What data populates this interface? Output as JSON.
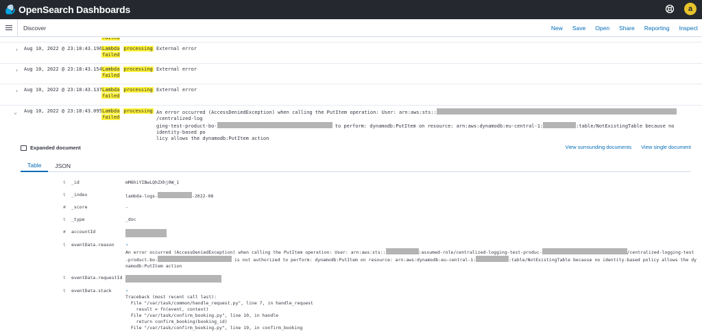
{
  "app": {
    "title": "OpenSearch Dashboards",
    "title_a": "Open",
    "title_b": "Search Dashboards",
    "avatar_letter": "a"
  },
  "breadcrumb": "Discover",
  "menu": [
    "New",
    "Save",
    "Open",
    "Share",
    "Reporting",
    "Inspect"
  ],
  "top_partial": {
    "word": "failed"
  },
  "rows": [
    {
      "time": "Aug 10, 2022 @ 23:18:43.196",
      "src_a": "Lambda",
      "src_b": "processing",
      "src_c": "failed",
      "msg": "External error"
    },
    {
      "time": "Aug 10, 2022 @ 23:18:43.154",
      "src_a": "Lambda",
      "src_b": "processing",
      "src_c": "failed",
      "msg": "External error"
    },
    {
      "time": "Aug 10, 2022 @ 23:18:43.137",
      "src_a": "Lambda",
      "src_b": "processing",
      "src_c": "failed",
      "msg": "External error"
    },
    {
      "time": "Aug 10, 2022 @ 23:18:43.095",
      "src_a": "Lambda",
      "src_b": "processing",
      "src_c": "failed",
      "msg_l1a": "An error occurred (AccessDeniedException) when calling the PutItem operation: User: arn:aws:sts::",
      "msg_l1b": "/centralized-log",
      "msg_l2a": "ging-test-product-bo-",
      "msg_l2b": " to perform: dynamodb:PutItem on resource: arn:aws:dynamodb:eu-central-1:",
      "msg_l2c": ":table/NotExistingTable because no identity-based po",
      "msg_l3": "licy allows the dynamodb:PutItem action"
    }
  ],
  "expanded": {
    "title": "Expanded document",
    "links": [
      "View surrounding documents",
      "View single document"
    ],
    "tabs": [
      "Table",
      "JSON"
    ]
  },
  "fields": [
    {
      "type": "t",
      "name": "_id",
      "value": "mM6hiYIBwLQhZXhj0W_1"
    },
    {
      "type": "t",
      "name": "_index",
      "value_a": "lambda-logs-",
      "value_b": "-2022-08"
    },
    {
      "type": "#",
      "name": "_score",
      "value": "-"
    },
    {
      "type": "t",
      "name": "_type",
      "value": "_doc"
    },
    {
      "type": "#",
      "name": "accountId"
    },
    {
      "type": "t",
      "name": "eventData.reason",
      "l1a": "An error occurred (AccessDeniedException) when calling the PutItem operation: User: arn:aws:sts::",
      "l1b": ":assumed-role/centralized-logging-test-produc-",
      "l1c": "/centralized-logging-test",
      "l2a": "-product-bo-",
      "l2b": " is not authorized to perform: dynamodb:PutItem on resource: arn:aws:dynamodb:eu-central-1:",
      "l2c": ":table/NotExistingTable because no identity-based policy allows the dy",
      "l3": "namodb:PutItem action"
    },
    {
      "type": "t",
      "name": "eventData.requestId"
    },
    {
      "type": "t",
      "name": "eventData.stack",
      "trace": "Traceback (most recent call last):\n  File \"/var/task/common/handle_request.py\", line 7, in handle_request\n    result = fn(event, context)\n  File \"/var/task/confirm_booking.py\", line 10, in handle\n    return confirm_booking(booking_id)\n  File \"/var/task/confirm_booking.py\", line 19, in confirm_booking"
    }
  ],
  "icons": {
    "expand": "chevron-right-icon",
    "collapse": "chevron-down-icon",
    "folder": "folder-icon",
    "help": "help-icon"
  },
  "colors": {
    "highlight": "#fff233",
    "link": "#006bb8",
    "topbar": "#25282f",
    "avatar": "#e7c22b"
  }
}
